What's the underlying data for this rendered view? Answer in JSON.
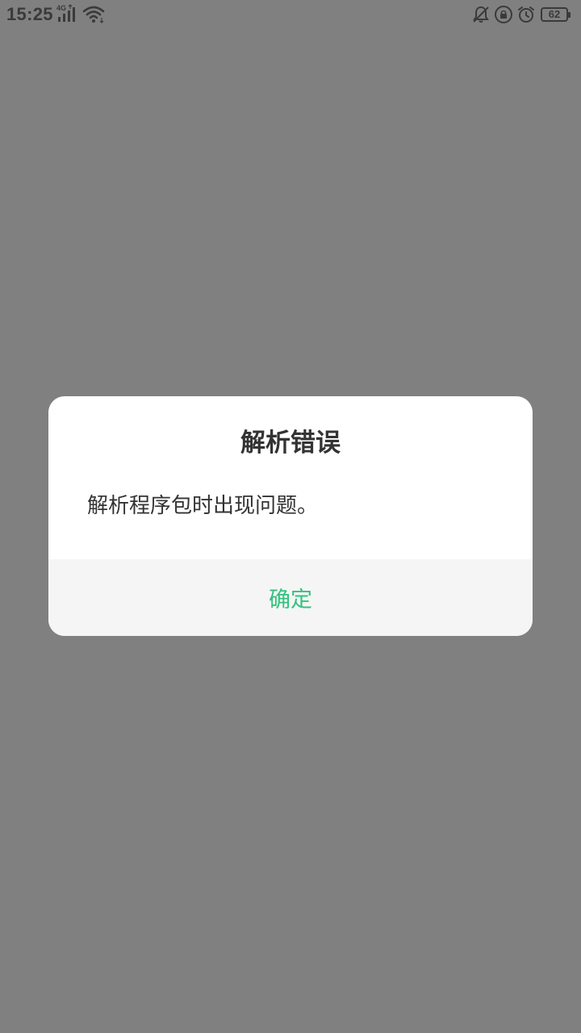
{
  "status_bar": {
    "time": "15:25",
    "network_type": "4G",
    "battery_level": "62",
    "icons": [
      "signal-icon",
      "wifi-icon",
      "bell-off-icon",
      "lock-rotate-icon",
      "alarm-icon",
      "battery-icon"
    ]
  },
  "dialog": {
    "title": "解析错误",
    "message": "解析程序包时出现问题。",
    "confirm_label": "确定"
  },
  "colors": {
    "overlay": "#808080",
    "dialog_background": "#ffffff",
    "actions_background": "#f5f5f5",
    "accent": "#31c27c",
    "text": "#333333"
  }
}
